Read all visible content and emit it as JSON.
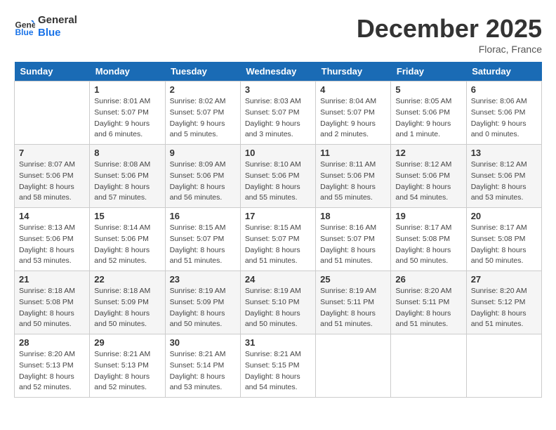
{
  "header": {
    "logo_line1": "General",
    "logo_line2": "Blue",
    "month": "December 2025",
    "location": "Florac, France"
  },
  "weekdays": [
    "Sunday",
    "Monday",
    "Tuesday",
    "Wednesday",
    "Thursday",
    "Friday",
    "Saturday"
  ],
  "weeks": [
    [
      {
        "day": "",
        "sunrise": "",
        "sunset": "",
        "daylight": ""
      },
      {
        "day": "1",
        "sunrise": "Sunrise: 8:01 AM",
        "sunset": "Sunset: 5:07 PM",
        "daylight": "Daylight: 9 hours and 6 minutes."
      },
      {
        "day": "2",
        "sunrise": "Sunrise: 8:02 AM",
        "sunset": "Sunset: 5:07 PM",
        "daylight": "Daylight: 9 hours and 5 minutes."
      },
      {
        "day": "3",
        "sunrise": "Sunrise: 8:03 AM",
        "sunset": "Sunset: 5:07 PM",
        "daylight": "Daylight: 9 hours and 3 minutes."
      },
      {
        "day": "4",
        "sunrise": "Sunrise: 8:04 AM",
        "sunset": "Sunset: 5:07 PM",
        "daylight": "Daylight: 9 hours and 2 minutes."
      },
      {
        "day": "5",
        "sunrise": "Sunrise: 8:05 AM",
        "sunset": "Sunset: 5:06 PM",
        "daylight": "Daylight: 9 hours and 1 minute."
      },
      {
        "day": "6",
        "sunrise": "Sunrise: 8:06 AM",
        "sunset": "Sunset: 5:06 PM",
        "daylight": "Daylight: 9 hours and 0 minutes."
      }
    ],
    [
      {
        "day": "7",
        "sunrise": "Sunrise: 8:07 AM",
        "sunset": "Sunset: 5:06 PM",
        "daylight": "Daylight: 8 hours and 58 minutes."
      },
      {
        "day": "8",
        "sunrise": "Sunrise: 8:08 AM",
        "sunset": "Sunset: 5:06 PM",
        "daylight": "Daylight: 8 hours and 57 minutes."
      },
      {
        "day": "9",
        "sunrise": "Sunrise: 8:09 AM",
        "sunset": "Sunset: 5:06 PM",
        "daylight": "Daylight: 8 hours and 56 minutes."
      },
      {
        "day": "10",
        "sunrise": "Sunrise: 8:10 AM",
        "sunset": "Sunset: 5:06 PM",
        "daylight": "Daylight: 8 hours and 55 minutes."
      },
      {
        "day": "11",
        "sunrise": "Sunrise: 8:11 AM",
        "sunset": "Sunset: 5:06 PM",
        "daylight": "Daylight: 8 hours and 55 minutes."
      },
      {
        "day": "12",
        "sunrise": "Sunrise: 8:12 AM",
        "sunset": "Sunset: 5:06 PM",
        "daylight": "Daylight: 8 hours and 54 minutes."
      },
      {
        "day": "13",
        "sunrise": "Sunrise: 8:12 AM",
        "sunset": "Sunset: 5:06 PM",
        "daylight": "Daylight: 8 hours and 53 minutes."
      }
    ],
    [
      {
        "day": "14",
        "sunrise": "Sunrise: 8:13 AM",
        "sunset": "Sunset: 5:06 PM",
        "daylight": "Daylight: 8 hours and 53 minutes."
      },
      {
        "day": "15",
        "sunrise": "Sunrise: 8:14 AM",
        "sunset": "Sunset: 5:06 PM",
        "daylight": "Daylight: 8 hours and 52 minutes."
      },
      {
        "day": "16",
        "sunrise": "Sunrise: 8:15 AM",
        "sunset": "Sunset: 5:07 PM",
        "daylight": "Daylight: 8 hours and 51 minutes."
      },
      {
        "day": "17",
        "sunrise": "Sunrise: 8:15 AM",
        "sunset": "Sunset: 5:07 PM",
        "daylight": "Daylight: 8 hours and 51 minutes."
      },
      {
        "day": "18",
        "sunrise": "Sunrise: 8:16 AM",
        "sunset": "Sunset: 5:07 PM",
        "daylight": "Daylight: 8 hours and 51 minutes."
      },
      {
        "day": "19",
        "sunrise": "Sunrise: 8:17 AM",
        "sunset": "Sunset: 5:08 PM",
        "daylight": "Daylight: 8 hours and 50 minutes."
      },
      {
        "day": "20",
        "sunrise": "Sunrise: 8:17 AM",
        "sunset": "Sunset: 5:08 PM",
        "daylight": "Daylight: 8 hours and 50 minutes."
      }
    ],
    [
      {
        "day": "21",
        "sunrise": "Sunrise: 8:18 AM",
        "sunset": "Sunset: 5:08 PM",
        "daylight": "Daylight: 8 hours and 50 minutes."
      },
      {
        "day": "22",
        "sunrise": "Sunrise: 8:18 AM",
        "sunset": "Sunset: 5:09 PM",
        "daylight": "Daylight: 8 hours and 50 minutes."
      },
      {
        "day": "23",
        "sunrise": "Sunrise: 8:19 AM",
        "sunset": "Sunset: 5:09 PM",
        "daylight": "Daylight: 8 hours and 50 minutes."
      },
      {
        "day": "24",
        "sunrise": "Sunrise: 8:19 AM",
        "sunset": "Sunset: 5:10 PM",
        "daylight": "Daylight: 8 hours and 50 minutes."
      },
      {
        "day": "25",
        "sunrise": "Sunrise: 8:19 AM",
        "sunset": "Sunset: 5:11 PM",
        "daylight": "Daylight: 8 hours and 51 minutes."
      },
      {
        "day": "26",
        "sunrise": "Sunrise: 8:20 AM",
        "sunset": "Sunset: 5:11 PM",
        "daylight": "Daylight: 8 hours and 51 minutes."
      },
      {
        "day": "27",
        "sunrise": "Sunrise: 8:20 AM",
        "sunset": "Sunset: 5:12 PM",
        "daylight": "Daylight: 8 hours and 51 minutes."
      }
    ],
    [
      {
        "day": "28",
        "sunrise": "Sunrise: 8:20 AM",
        "sunset": "Sunset: 5:13 PM",
        "daylight": "Daylight: 8 hours and 52 minutes."
      },
      {
        "day": "29",
        "sunrise": "Sunrise: 8:21 AM",
        "sunset": "Sunset: 5:13 PM",
        "daylight": "Daylight: 8 hours and 52 minutes."
      },
      {
        "day": "30",
        "sunrise": "Sunrise: 8:21 AM",
        "sunset": "Sunset: 5:14 PM",
        "daylight": "Daylight: 8 hours and 53 minutes."
      },
      {
        "day": "31",
        "sunrise": "Sunrise: 8:21 AM",
        "sunset": "Sunset: 5:15 PM",
        "daylight": "Daylight: 8 hours and 54 minutes."
      },
      {
        "day": "",
        "sunrise": "",
        "sunset": "",
        "daylight": ""
      },
      {
        "day": "",
        "sunrise": "",
        "sunset": "",
        "daylight": ""
      },
      {
        "day": "",
        "sunrise": "",
        "sunset": "",
        "daylight": ""
      }
    ]
  ]
}
